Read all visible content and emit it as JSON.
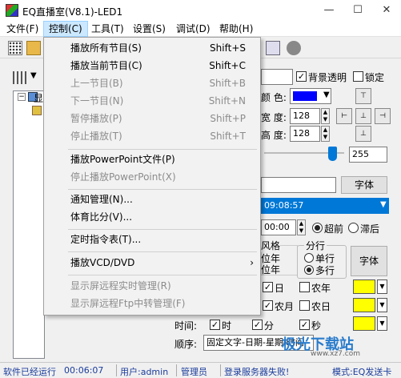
{
  "window": {
    "title": "EQ直播室(V8.1)-LED1",
    "min_label": "—",
    "max_label": "☐",
    "close_label": "✕"
  },
  "menubar": {
    "items": [
      "文件(F)",
      "控制(C)",
      "工具(T)",
      "设置(S)",
      "调试(D)",
      "帮助(H)"
    ],
    "active_index": 1
  },
  "dropdown": {
    "items": [
      {
        "label": "播放所有节目(S)",
        "shortcut": "Shift+S",
        "enabled": true
      },
      {
        "label": "播放当前节目(C)",
        "shortcut": "Shift+C",
        "enabled": true
      },
      {
        "label": "上一节目(B)",
        "shortcut": "Shift+B",
        "enabled": false
      },
      {
        "label": "下一节目(N)",
        "shortcut": "Shift+N",
        "enabled": false
      },
      {
        "label": "暂停播放(P)",
        "shortcut": "Shift+P",
        "enabled": false
      },
      {
        "label": "停止播放(T)",
        "shortcut": "Shift+T",
        "enabled": false
      },
      {
        "label": "播放PowerPoint文件(P)",
        "shortcut": "",
        "enabled": true
      },
      {
        "label": "停止播放PowerPoint(X)",
        "shortcut": "",
        "enabled": false
      },
      {
        "label": "通知管理(N)...",
        "shortcut": "",
        "enabled": true
      },
      {
        "label": "体育比分(V)...",
        "shortcut": "",
        "enabled": true
      },
      {
        "label": "定时指令表(T)...",
        "shortcut": "",
        "enabled": true
      },
      {
        "label": "播放VCD/DVD",
        "shortcut": "",
        "enabled": true,
        "submenu": true
      },
      {
        "label": "显示屏远程实时管理(R)",
        "shortcut": "",
        "enabled": false
      },
      {
        "label": "显示屏远程Ftp中转管理(F)",
        "shortcut": "",
        "enabled": false
      }
    ],
    "submenu_arrow": "›"
  },
  "tree": {
    "root_label": "显"
  },
  "props": {
    "bg_transparent_label": "背景透明",
    "bg_transparent": true,
    "lock_label": "锁定",
    "lock": false,
    "color_label": "颜 色:",
    "color_value": "#0000ff",
    "width_label": "宽 度:",
    "width_value": "128",
    "height_label": "高 度:",
    "height_value": "128",
    "slider_value": "255",
    "font_button": "字体",
    "datetime_value": "09:08:57",
    "time_value": "00:00",
    "advance_label": "超前",
    "lag_label": "滞后",
    "advance_selected": true,
    "style_label": "风格",
    "style_lines": [
      "位年",
      "位年"
    ],
    "line_group_label": "分行",
    "single_line_label": "单行",
    "multi_line_label": "多行",
    "multi_selected": true,
    "font_button2": "字体",
    "day_label": "日",
    "day_checked": true,
    "lunar_year_label": "农年",
    "lunar_year_checked": false,
    "lunar_month_label": "农月",
    "lunar_month_checked": true,
    "lunar_day_label": "农日",
    "lunar_day_checked": false,
    "time_row_label": "时间:",
    "hour_label": "时",
    "hour_checked": true,
    "minute_label": "分",
    "minute_checked": true,
    "second_label": "秒",
    "second_checked": true,
    "order_label": "顺序:",
    "order_value": "固定文字-日期-星期-时间",
    "swatch_color": "#ffff00"
  },
  "statusbar": {
    "run": "软件已经运行",
    "run_time": "00:06:07",
    "user": "用户:admin",
    "role": "管理员",
    "login": "登录服务器失败!",
    "mode": "模式:EQ发送卡"
  },
  "watermark": {
    "text": "极光下载站",
    "sub": "www.xz7.com"
  }
}
